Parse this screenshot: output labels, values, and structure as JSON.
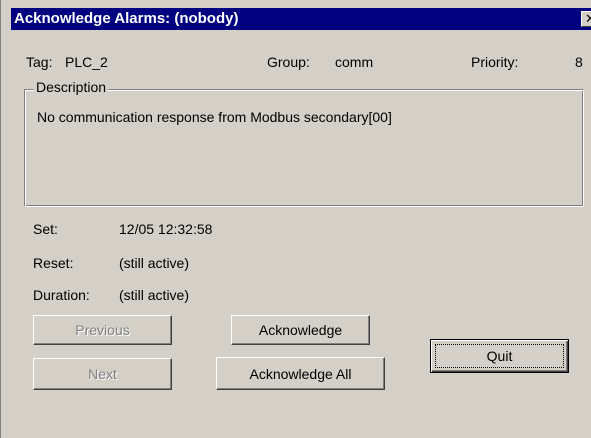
{
  "window": {
    "title": "Acknowledge Alarms: (nobody)",
    "close_glyph": "✕"
  },
  "alarm": {
    "tag_label": "Tag:",
    "tag_value": "PLC_2",
    "group_label": "Group:",
    "group_value": "comm",
    "priority_label": "Priority:",
    "priority_value": "8"
  },
  "description": {
    "legend": "Description",
    "text": "No communication response from Modbus secondary[00]"
  },
  "times": {
    "set_label": "Set:",
    "set_value": "12/05 12:32:58",
    "reset_label": "Reset:",
    "reset_value": "(still active)",
    "duration_label": "Duration:",
    "duration_value": "(still active)"
  },
  "buttons": {
    "previous": "Previous",
    "next": "Next",
    "acknowledge": "Acknowledge",
    "acknowledge_all": "Acknowledge All",
    "quit": "Quit"
  },
  "state": {
    "previous_enabled": false,
    "next_enabled": false,
    "default_button": "quit"
  },
  "colors": {
    "titlebar": "#000080",
    "dialog_face": "#d4d0c8",
    "disabled_text": "#808080"
  },
  "icons": {
    "close": "close-icon"
  }
}
